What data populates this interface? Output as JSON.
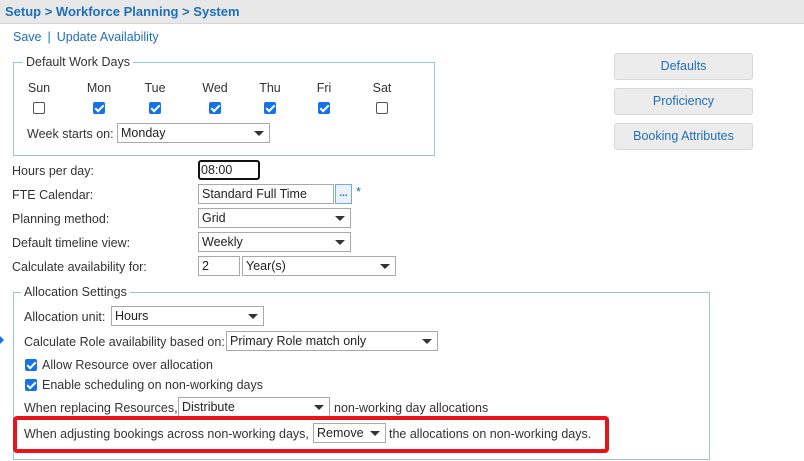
{
  "breadcrumb": "Setup > Workforce Planning > System",
  "actions": {
    "save": "Save",
    "separator": "|",
    "update": "Update Availability"
  },
  "default_work_days": {
    "legend": "Default Work Days",
    "days": [
      {
        "label": "Sun",
        "checked": false
      },
      {
        "label": "Mon",
        "checked": true
      },
      {
        "label": "Tue",
        "checked": true
      },
      {
        "label": "Wed",
        "checked": true
      },
      {
        "label": "Thu",
        "checked": true
      },
      {
        "label": "Fri",
        "checked": true
      },
      {
        "label": "Sat",
        "checked": false
      }
    ],
    "week_starts_label": "Week starts on:",
    "week_starts_value": "Monday"
  },
  "side_buttons": {
    "defaults": "Defaults",
    "proficiency": "Proficiency",
    "booking_attributes": "Booking Attributes"
  },
  "fields": {
    "hours_per_day_label": "Hours per day:",
    "hours_per_day_value": "08:00",
    "fte_calendar_label": "FTE Calendar:",
    "fte_calendar_value": "Standard Full Time",
    "fte_lookup": "...",
    "required_marker": "*",
    "planning_method_label": "Planning method:",
    "planning_method_value": "Grid",
    "timeline_view_label": "Default timeline view:",
    "timeline_view_value": "Weekly",
    "calc_availability_label": "Calculate availability for:",
    "calc_availability_number": "2",
    "calc_availability_unit": "Year(s)"
  },
  "allocation": {
    "legend": "Allocation Settings",
    "unit_label": "Allocation unit:",
    "unit_value": "Hours",
    "role_label": "Calculate Role availability based on:",
    "role_value": "Primary Role match only",
    "allow_over_label": "Allow Resource over allocation",
    "allow_over_checked": true,
    "enable_sched_label": "Enable scheduling on non-working days",
    "enable_sched_checked": true,
    "replacing_prefix": "When replacing Resources,",
    "replacing_value": "Distribute",
    "replacing_suffix": "non-working day allocations",
    "adjusting_prefix": "When adjusting bookings across non-working days,",
    "adjusting_value": "Remove",
    "adjusting_suffix": "the allocations on non-working days."
  },
  "colors": {
    "link": "#1f6fb8",
    "checkbox": "#1473e6",
    "highlight": "#e8141c",
    "fieldset_border": "#9cc3dc"
  }
}
